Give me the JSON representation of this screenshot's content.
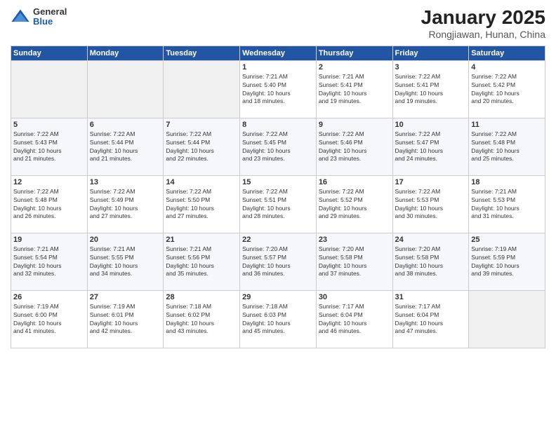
{
  "logo": {
    "general": "General",
    "blue": "Blue"
  },
  "header": {
    "title": "January 2025",
    "subtitle": "Rongjiawan, Hunan, China"
  },
  "weekdays": [
    "Sunday",
    "Monday",
    "Tuesday",
    "Wednesday",
    "Thursday",
    "Friday",
    "Saturday"
  ],
  "weeks": [
    [
      {
        "day": "",
        "empty": true
      },
      {
        "day": "",
        "empty": true
      },
      {
        "day": "",
        "empty": true
      },
      {
        "day": "1",
        "sunrise": "7:21 AM",
        "sunset": "5:40 PM",
        "daylight": "10 hours and 18 minutes."
      },
      {
        "day": "2",
        "sunrise": "7:21 AM",
        "sunset": "5:41 PM",
        "daylight": "10 hours and 19 minutes."
      },
      {
        "day": "3",
        "sunrise": "7:22 AM",
        "sunset": "5:41 PM",
        "daylight": "10 hours and 19 minutes."
      },
      {
        "day": "4",
        "sunrise": "7:22 AM",
        "sunset": "5:42 PM",
        "daylight": "10 hours and 20 minutes."
      }
    ],
    [
      {
        "day": "5",
        "sunrise": "7:22 AM",
        "sunset": "5:43 PM",
        "daylight": "10 hours and 21 minutes."
      },
      {
        "day": "6",
        "sunrise": "7:22 AM",
        "sunset": "5:44 PM",
        "daylight": "10 hours and 21 minutes."
      },
      {
        "day": "7",
        "sunrise": "7:22 AM",
        "sunset": "5:44 PM",
        "daylight": "10 hours and 22 minutes."
      },
      {
        "day": "8",
        "sunrise": "7:22 AM",
        "sunset": "5:45 PM",
        "daylight": "10 hours and 23 minutes."
      },
      {
        "day": "9",
        "sunrise": "7:22 AM",
        "sunset": "5:46 PM",
        "daylight": "10 hours and 23 minutes."
      },
      {
        "day": "10",
        "sunrise": "7:22 AM",
        "sunset": "5:47 PM",
        "daylight": "10 hours and 24 minutes."
      },
      {
        "day": "11",
        "sunrise": "7:22 AM",
        "sunset": "5:48 PM",
        "daylight": "10 hours and 25 minutes."
      }
    ],
    [
      {
        "day": "12",
        "sunrise": "7:22 AM",
        "sunset": "5:48 PM",
        "daylight": "10 hours and 26 minutes."
      },
      {
        "day": "13",
        "sunrise": "7:22 AM",
        "sunset": "5:49 PM",
        "daylight": "10 hours and 27 minutes."
      },
      {
        "day": "14",
        "sunrise": "7:22 AM",
        "sunset": "5:50 PM",
        "daylight": "10 hours and 27 minutes."
      },
      {
        "day": "15",
        "sunrise": "7:22 AM",
        "sunset": "5:51 PM",
        "daylight": "10 hours and 28 minutes."
      },
      {
        "day": "16",
        "sunrise": "7:22 AM",
        "sunset": "5:52 PM",
        "daylight": "10 hours and 29 minutes."
      },
      {
        "day": "17",
        "sunrise": "7:22 AM",
        "sunset": "5:53 PM",
        "daylight": "10 hours and 30 minutes."
      },
      {
        "day": "18",
        "sunrise": "7:21 AM",
        "sunset": "5:53 PM",
        "daylight": "10 hours and 31 minutes."
      }
    ],
    [
      {
        "day": "19",
        "sunrise": "7:21 AM",
        "sunset": "5:54 PM",
        "daylight": "10 hours and 32 minutes."
      },
      {
        "day": "20",
        "sunrise": "7:21 AM",
        "sunset": "5:55 PM",
        "daylight": "10 hours and 34 minutes."
      },
      {
        "day": "21",
        "sunrise": "7:21 AM",
        "sunset": "5:56 PM",
        "daylight": "10 hours and 35 minutes."
      },
      {
        "day": "22",
        "sunrise": "7:20 AM",
        "sunset": "5:57 PM",
        "daylight": "10 hours and 36 minutes."
      },
      {
        "day": "23",
        "sunrise": "7:20 AM",
        "sunset": "5:58 PM",
        "daylight": "10 hours and 37 minutes."
      },
      {
        "day": "24",
        "sunrise": "7:20 AM",
        "sunset": "5:58 PM",
        "daylight": "10 hours and 38 minutes."
      },
      {
        "day": "25",
        "sunrise": "7:19 AM",
        "sunset": "5:59 PM",
        "daylight": "10 hours and 39 minutes."
      }
    ],
    [
      {
        "day": "26",
        "sunrise": "7:19 AM",
        "sunset": "6:00 PM",
        "daylight": "10 hours and 41 minutes."
      },
      {
        "day": "27",
        "sunrise": "7:19 AM",
        "sunset": "6:01 PM",
        "daylight": "10 hours and 42 minutes."
      },
      {
        "day": "28",
        "sunrise": "7:18 AM",
        "sunset": "6:02 PM",
        "daylight": "10 hours and 43 minutes."
      },
      {
        "day": "29",
        "sunrise": "7:18 AM",
        "sunset": "6:03 PM",
        "daylight": "10 hours and 45 minutes."
      },
      {
        "day": "30",
        "sunrise": "7:17 AM",
        "sunset": "6:04 PM",
        "daylight": "10 hours and 46 minutes."
      },
      {
        "day": "31",
        "sunrise": "7:17 AM",
        "sunset": "6:04 PM",
        "daylight": "10 hours and 47 minutes."
      },
      {
        "day": "",
        "empty": true
      }
    ]
  ],
  "labels": {
    "sunrise": "Sunrise:",
    "sunset": "Sunset:",
    "daylight": "Daylight:"
  }
}
